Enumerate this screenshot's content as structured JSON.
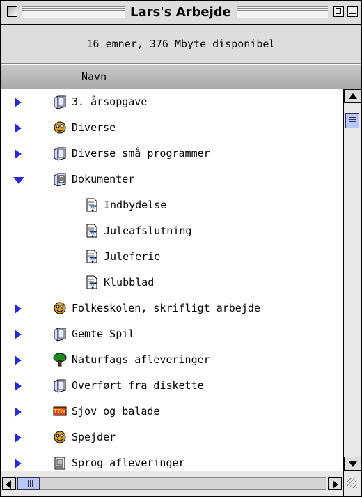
{
  "window": {
    "title": "Lars's Arbejde",
    "info": "16 emner, 376 Mbyte disponibel",
    "column_header": "Navn"
  },
  "items": [
    {
      "label": "3. årsopgave",
      "icon": "folder-icon",
      "expanded": false
    },
    {
      "label": "Diverse",
      "icon": "custom-folder-icon",
      "expanded": false
    },
    {
      "label": "Diverse små programmer",
      "icon": "folder-icon",
      "expanded": false
    },
    {
      "label": "Dokumenter",
      "icon": "documents-folder-icon",
      "expanded": true,
      "children": [
        {
          "label": "Indbydelse",
          "icon": "text-document-icon"
        },
        {
          "label": "Juleafslutning",
          "icon": "text-document-icon"
        },
        {
          "label": "Juleferie",
          "icon": "text-document-icon"
        },
        {
          "label": "Klubblad",
          "icon": "text-document-icon"
        }
      ]
    },
    {
      "label": "Folkeskolen, skrifligt arbejde",
      "icon": "custom-folder-icon",
      "expanded": false
    },
    {
      "label": "Gemte Spil",
      "icon": "folder-icon",
      "expanded": false
    },
    {
      "label": "Naturfags afleveringer",
      "icon": "tree-folder-icon",
      "expanded": false
    },
    {
      "label": "Overført fra diskette",
      "icon": "folder-icon",
      "expanded": false
    },
    {
      "label": "Sjov og balade",
      "icon": "toy-folder-icon",
      "expanded": false
    },
    {
      "label": "Spejder",
      "icon": "custom-folder-icon",
      "expanded": false
    },
    {
      "label": "Sprog afleveringer",
      "icon": "notepad-folder-icon",
      "expanded": false
    }
  ],
  "colors": {
    "disclosure_triangle": "#2a2ad0",
    "scroll_thumb": "#b9c6ff",
    "window_chrome": "#dddddd"
  }
}
